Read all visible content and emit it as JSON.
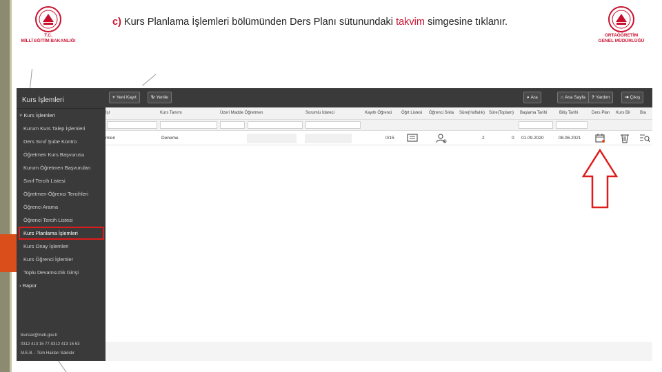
{
  "slide": {
    "step_label": "c)",
    "title_before": " Kurs Planlama İşlemleri bölümünden Ders Planı sütunundaki ",
    "title_highlight": "takvim",
    "title_after": " simgesine tıklanır.",
    "accent_color": "#c8102e"
  },
  "logos": {
    "left": {
      "line1": "T.C.",
      "line2": "MİLLÎ EĞİTİM BAKANLIĞI"
    },
    "right": {
      "line1": "ORTAÖĞRETİM",
      "line2": "GENEL MÜDÜRLÜĞÜ"
    }
  },
  "sidebar": {
    "title": "Kurs İşlemleri",
    "parent_label": "Kurs İşlemleri",
    "items": [
      "Kurum Kurs Talep İşlemleri",
      "Ders Sınıf Şube Kontro",
      "Öğretmen Kurs Başvurusu",
      "Kurum Öğretmen Başvuruları",
      "Sınıf Tercih Listesi",
      "Öğretmen-Öğrenci Tercihleri",
      "Öğrenci Arama",
      "Öğrenci Tercih Listesi",
      "Kurs Planlama İşlemleri",
      "Kurs Onay İşlemleri",
      "Kurs Öğrenci İşlemler",
      "Toplu Devamsızlık Girişi"
    ],
    "rapor_label": "Rapor",
    "footer": {
      "email": "lkurslar@meb.gov.tr",
      "phone": "0312 413 15 77-0312 413 15 53",
      "copyright": "M.E.B. - Tüm Hakları Saklıdır"
    }
  },
  "toolbar": {
    "new_record": "Yeni Kayıt",
    "refresh": "Yenile",
    "search": "Ara",
    "search_page": "Ana Sayfa",
    "help": "Yardım",
    "exit": "Çıkış"
  },
  "table": {
    "headers": [
      "İşl",
      "Kurs Tanımı",
      "Üzeri Madde Öğretmen",
      "Sorumlu İdareci",
      "Kayıtlı Öğrenci",
      "Öğrt Listesi",
      "Öğrenci Sıkla",
      "Süre(Haftalık)",
      "Süre(Toplam)",
      "Başlama Tarihi",
      "Bitiş Tarihi",
      "Ders Plan",
      "Kurs Bil",
      "Bla"
    ],
    "row": {
      "islem": "mleri",
      "kurs_tanimi": "Deneme",
      "kayitli_ogrenci": "0/15",
      "sure_haftalik": "2",
      "sure_toplam": "0",
      "baslama": "01.09.2020",
      "bitis": "08.06.2021"
    }
  }
}
